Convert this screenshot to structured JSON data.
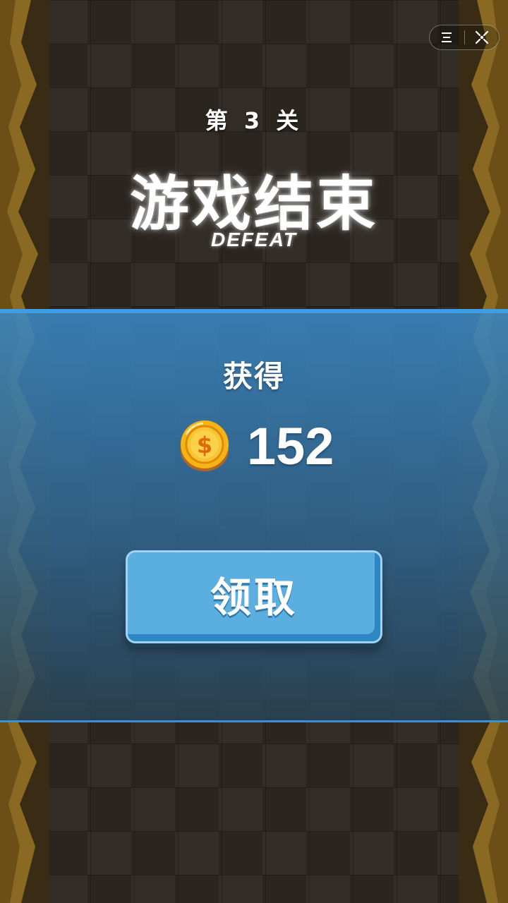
{
  "level_label": "第 3 关",
  "title": "游戏结束",
  "subtitle": "DEFEAT",
  "reward": {
    "earned_label": "获得",
    "coin_icon": "dollar-coin-icon",
    "amount": "152"
  },
  "claim_button_label": "领取",
  "capsule": {
    "menu_icon": "menu-icon",
    "close_icon": "close-target-icon"
  },
  "colors": {
    "band_accent": "#3f9de6",
    "button": "#5aaee0",
    "coin": "#f5b315",
    "wall": "#7a5a1c"
  }
}
